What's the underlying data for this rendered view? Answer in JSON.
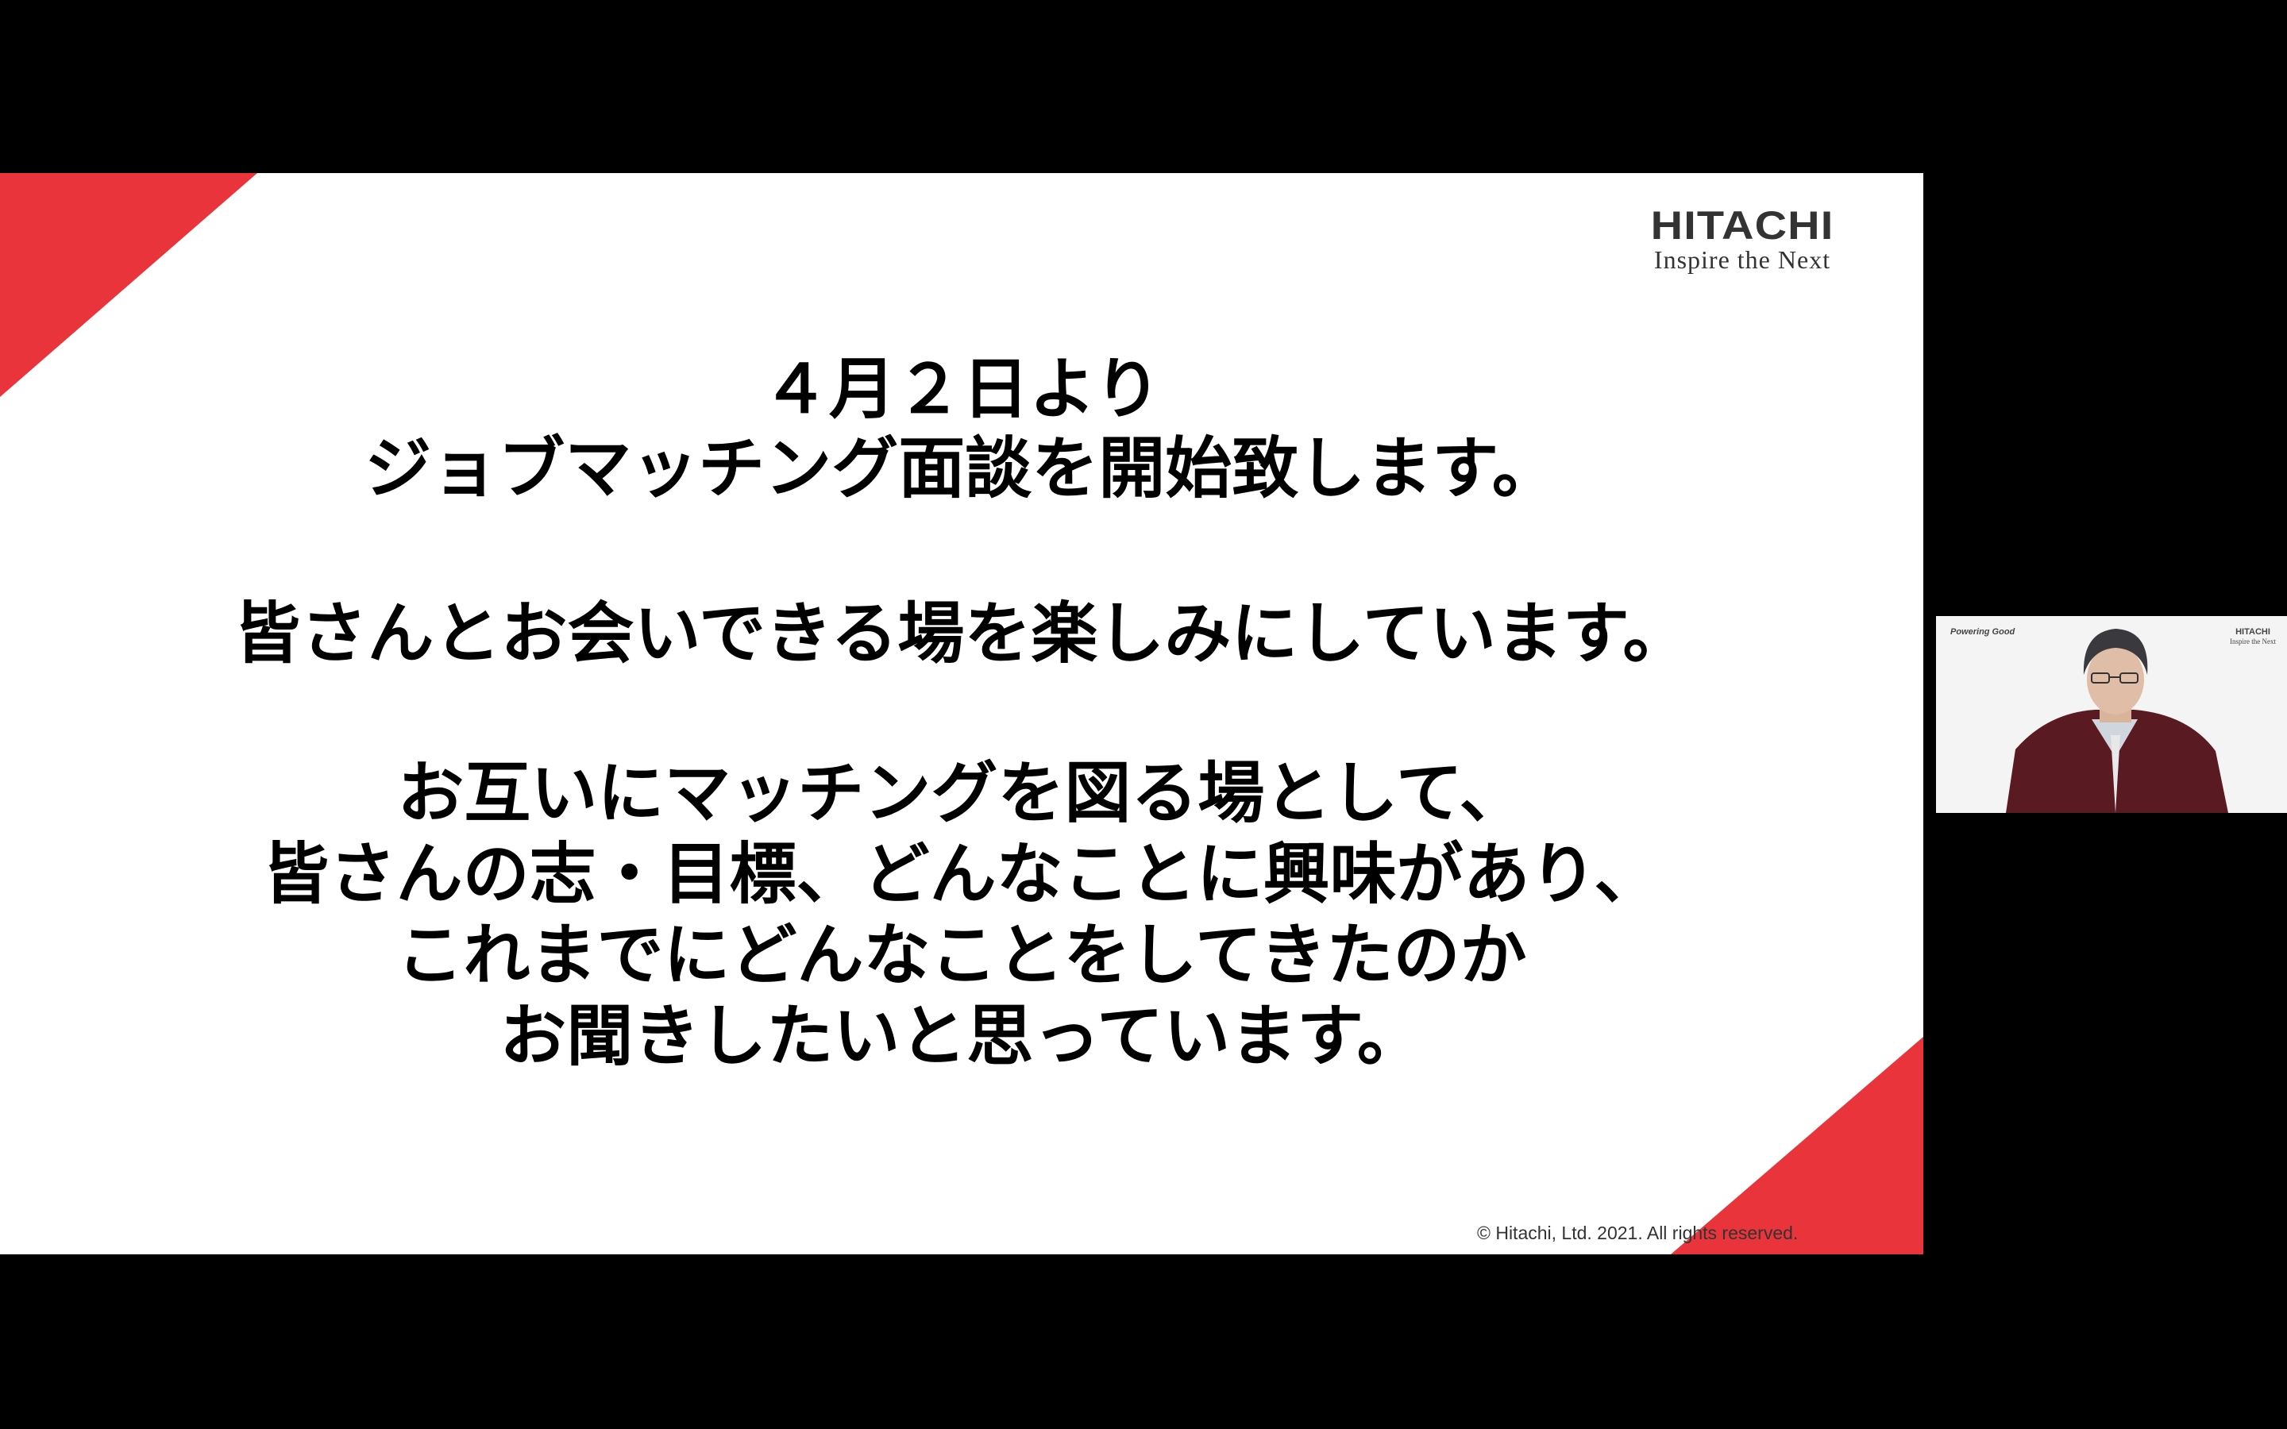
{
  "slide": {
    "brand": "HITACHI",
    "tagline": "Inspire the Next",
    "heading_lines": [
      "４月２日より",
      "ジョブマッチング面談を開始致します。"
    ],
    "line_2": "皆さんとお会いできる場を楽しみにしています。",
    "paragraph_lines": [
      "お互いにマッチングを図る場として、",
      "皆さんの志・目標、どんなことに興味があり、",
      "これまでにどんなことをしてきたのか",
      "お聞きしたいと思っています。"
    ],
    "copyright": "© Hitachi, Ltd. 2021. All rights reserved.",
    "accent_color": "#e8343a"
  },
  "camera": {
    "left_logo": "Powering Good",
    "right_brand": "HITACHI",
    "right_tag": "Inspire the Next"
  }
}
